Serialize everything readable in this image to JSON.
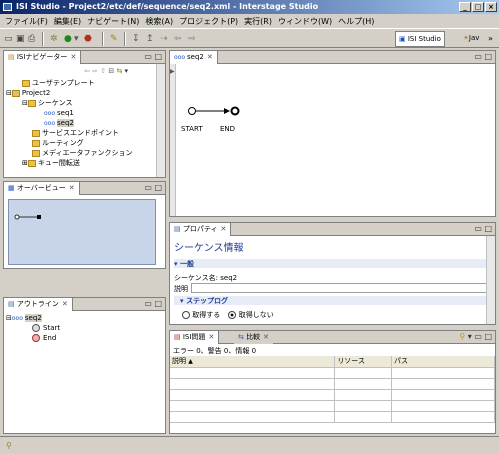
{
  "window": {
    "title": "ISI Studio - Project2/etc/def/sequence/seq2.xml - Interstage Studio",
    "buttons": [
      "_",
      "□",
      "×"
    ]
  },
  "menu": [
    "ファイル(F)",
    "編集(E)",
    "ナビゲート(N)",
    "検索(A)",
    "プロジェクト(P)",
    "実行(R)",
    "ウィンドウ(W)",
    "ヘルプ(H)"
  ],
  "perspectives": {
    "active": "ISI Studio",
    "other": "Jav",
    "more": "»"
  },
  "navigator": {
    "tab": "ISIナビゲーター",
    "tree": [
      "ユーザテンプレート",
      "Project2",
      "シーケンス",
      "seq1",
      "seq2",
      "サービスエンドポイント",
      "ルーティング",
      "メディエータファンクション",
      "キュー間転送"
    ]
  },
  "overview": {
    "tab": "オーバービュー"
  },
  "outline": {
    "tab": "アウトライン",
    "items": [
      "seq2",
      "Start",
      "End"
    ]
  },
  "editor": {
    "tab": "seq2",
    "start_label": "START",
    "end_label": "END"
  },
  "properties": {
    "tab": "プロパティ",
    "heading": "シーケンス情報",
    "general_section": "一般",
    "name_label": "シーケンス名:",
    "name_value": "seq2",
    "desc_label": "説明",
    "steplog_section": "ステップログ",
    "radio_get": "取得する",
    "radio_noget": "取得しない",
    "radio_selected": "取得しない"
  },
  "problems": {
    "tab": "ISI問題",
    "tab2": "比較",
    "summary": "エラー 0、警告 0、情報 0",
    "columns": [
      "説明",
      "リソース",
      "パス"
    ]
  },
  "colors": {
    "title_start": "#0a246a",
    "title_end": "#a6caf0",
    "section": "#1f3a93",
    "overview_bg": "#c8d4e8"
  }
}
